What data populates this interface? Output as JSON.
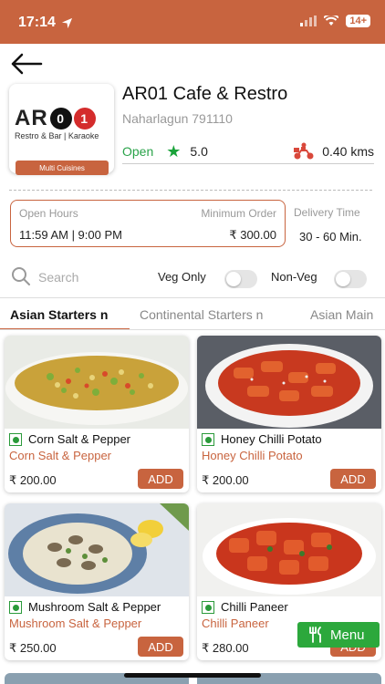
{
  "status_bar": {
    "time": "17:14",
    "battery": "14+"
  },
  "restaurant": {
    "logo_text": "AR",
    "logo_digit1": "0",
    "logo_digit2": "1",
    "logo_sub": "Restro & Bar | Karaoke",
    "cuisine_badge": "Multi Cuisines",
    "name": "AR01 Cafe & Restro",
    "location": "Naharlagun 791110",
    "status": "Open",
    "rating": "5.0",
    "distance": "0.40 kms"
  },
  "info": {
    "open_hours_label": "Open Hours",
    "open_hours_value": "11:59 AM | 9:00 PM",
    "min_order_label": "Minimum Order",
    "min_order_value": "₹ 300.00",
    "delivery_label": "Delivery Time",
    "delivery_value": "30 - 60 Min."
  },
  "filters": {
    "search_placeholder": "Search",
    "veg_only": "Veg Only",
    "non_veg": "Non-Veg"
  },
  "tabs": [
    "Asian Starters n",
    "Continental Starters n",
    "Asian Main"
  ],
  "items": [
    {
      "title": "Corn Salt & Pepper",
      "subtitle": "Corn Salt & Pepper",
      "price": "₹ 200.00",
      "add": "ADD"
    },
    {
      "title": "Honey Chilli Potato",
      "subtitle": "Honey Chilli Potato",
      "price": "₹ 200.00",
      "add": "ADD"
    },
    {
      "title": "Mushroom Salt & Pepper",
      "subtitle": "Mushroom Salt & Pepper",
      "price": "₹ 250.00",
      "add": "ADD"
    },
    {
      "title": "Chilli Paneer",
      "subtitle": "Chilli Paneer",
      "price": "₹ 280.00",
      "add": "ADD"
    }
  ],
  "menu_button": "Menu",
  "colors": {
    "accent": "#c8643f",
    "green": "#2ca83c"
  }
}
